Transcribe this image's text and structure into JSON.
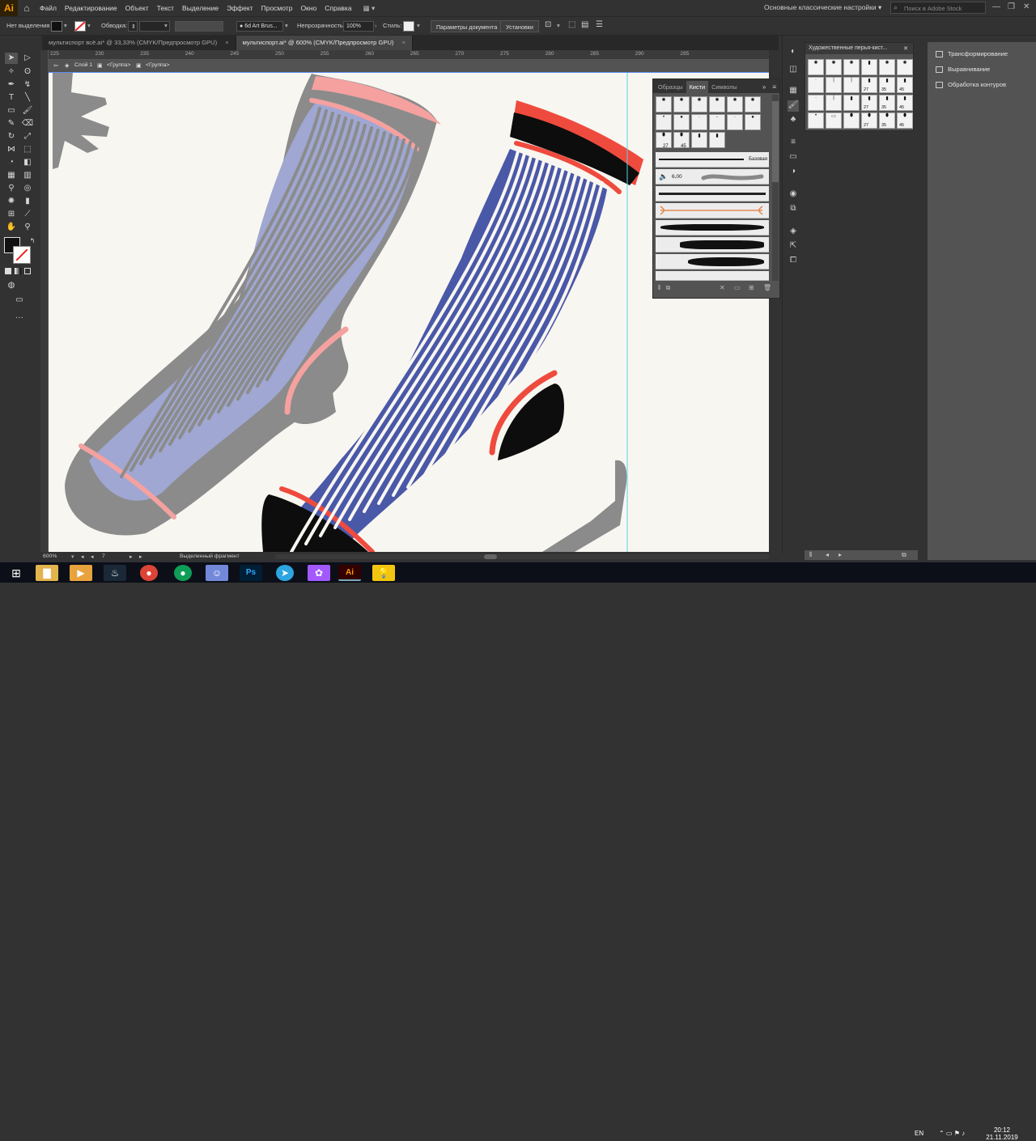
{
  "app": {
    "logo": "Ai"
  },
  "menubar": {
    "items": [
      "Файл",
      "Редактирование",
      "Объект",
      "Текст",
      "Выделение",
      "Эффект",
      "Просмотр",
      "Окно",
      "Справка"
    ],
    "workspace": "Основные классические настройки",
    "search_placeholder": "Поиск в Adobe Stock"
  },
  "controlbar": {
    "selection": "Нет выделения",
    "stroke_label": "Обводка:",
    "brush_name": "6d Art Brus...",
    "opacity_label": "Непрозрачность:",
    "opacity_value": "100%",
    "style_label": "Стиль:",
    "doc_params": "Параметры документа",
    "settings": "Установки"
  },
  "tabs": [
    {
      "label": "мультиспорт всё.ai* @ 33,33% (CMYK/Предпросмотр GPU)"
    },
    {
      "label": "мультиспорт.ai* @ 600% (CMYK/Предпросмотр GPU)"
    }
  ],
  "tab_close": "×",
  "ruler": {
    "h": [
      "225",
      "230",
      "235",
      "240",
      "245",
      "250",
      "255",
      "260",
      "265",
      "270",
      "275",
      "280",
      "285",
      "290",
      "295"
    ]
  },
  "breadcrumb": {
    "layer": "Слой 1",
    "group1": "<Группа>",
    "group2": "<Группа>"
  },
  "brushes_panel": {
    "tabs": [
      "Образцы",
      "Кисти",
      "Символы"
    ],
    "numbers": [
      "27",
      "45"
    ],
    "basic_label": "Базовая",
    "size_value": "6,00"
  },
  "art_panel": {
    "title": "Художественные перья-кист...",
    "numbers": [
      "27",
      "35",
      "45"
    ]
  },
  "right_panel": {
    "items": [
      "Трансформирование",
      "Выравнивание",
      "Обработка контуров"
    ]
  },
  "status": {
    "zoom": "600%",
    "artboard": "7",
    "tool": "Выделенный фрагмент"
  },
  "taskbar": {
    "lang": "EN",
    "time": "20:12",
    "date": "21.11.2019"
  },
  "colors": {
    "sock_light": "#9fa7d2",
    "sock_dark": "#4a58a8",
    "grey": "#8b8b8b",
    "pink": "#f4a1a0",
    "red": "#ef4a3e",
    "black": "#0d0d0d",
    "paper": "#f8f6f0"
  }
}
